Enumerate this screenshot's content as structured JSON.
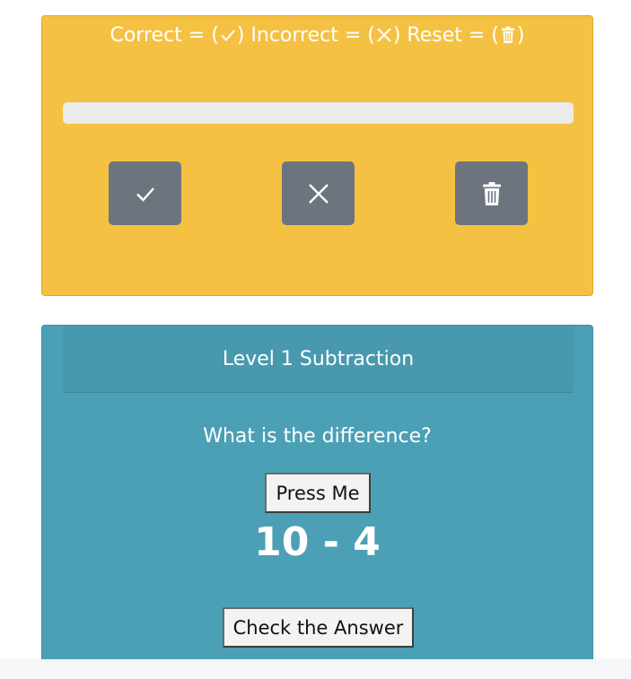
{
  "tracker": {
    "legend": {
      "correct_label": "Correct = (",
      "incorrect_label": ") Incorrect = (",
      "reset_label": ") Reset = (",
      "close_paren": ")"
    },
    "progress_fraction": 0,
    "buttons": {
      "correct_icon": "check-icon",
      "incorrect_icon": "x-icon",
      "reset_icon": "trash-icon"
    },
    "colors": {
      "card": "#f5c143",
      "button": "#6c757d",
      "track": "#ebebeb"
    }
  },
  "question": {
    "header": "Level 1 Subtraction",
    "prompt": "What is the difference?",
    "press_label": "Press Me",
    "problem": "10 - 4",
    "check_label": "Check the Answer",
    "colors": {
      "card": "#4ba0b6"
    }
  }
}
